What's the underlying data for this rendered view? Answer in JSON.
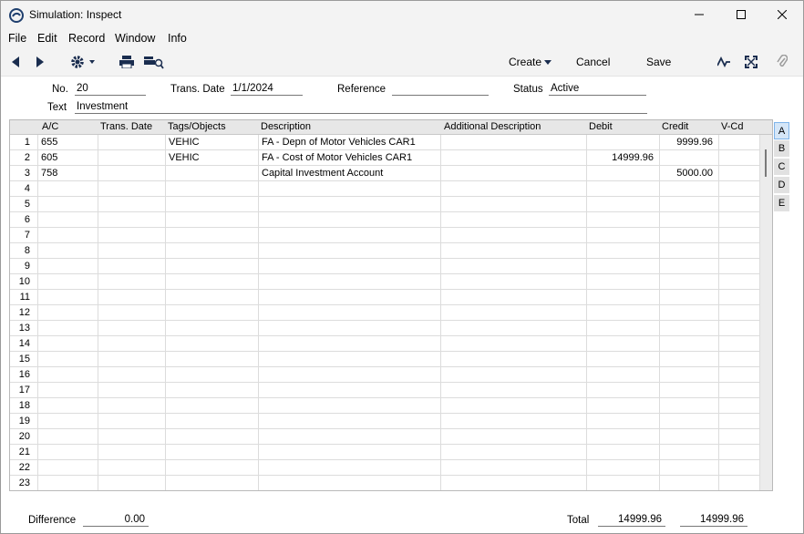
{
  "window": {
    "title": "Simulation: Inspect"
  },
  "menu": [
    "File",
    "Edit",
    "Record",
    "Window",
    "Info"
  ],
  "toolbar": {
    "create_label": "Create",
    "cancel_label": "Cancel",
    "save_label": "Save"
  },
  "header": {
    "no_label": "No.",
    "no_value": "20",
    "trans_date_label": "Trans. Date",
    "trans_date_value": "1/1/2024",
    "reference_label": "Reference",
    "reference_value": "",
    "status_label": "Status",
    "status_value": "Active",
    "text_label": "Text",
    "text_value": "Investment"
  },
  "grid": {
    "columns": [
      "A/C",
      "Trans. Date",
      "Tags/Objects",
      "Description",
      "Additional Description",
      "Debit",
      "Credit",
      "V-Cd"
    ],
    "rows": [
      {
        "n": "1",
        "ac": "655",
        "date": "",
        "tags": "VEHIC",
        "desc": "FA - Depn of Motor Vehicles CAR1",
        "add": "",
        "debit": "",
        "credit": "9999.96",
        "vcd": ""
      },
      {
        "n": "2",
        "ac": "605",
        "date": "",
        "tags": "VEHIC",
        "desc": "FA - Cost of Motor Vehicles CAR1",
        "add": "",
        "debit": "14999.96",
        "credit": "",
        "vcd": ""
      },
      {
        "n": "3",
        "ac": "758",
        "date": "",
        "tags": "",
        "desc": "Capital Investment Account",
        "add": "",
        "debit": "",
        "credit": "5000.00",
        "vcd": ""
      },
      {
        "n": "4"
      },
      {
        "n": "5"
      },
      {
        "n": "6"
      },
      {
        "n": "7"
      },
      {
        "n": "8"
      },
      {
        "n": "9"
      },
      {
        "n": "10"
      },
      {
        "n": "11"
      },
      {
        "n": "12"
      },
      {
        "n": "13"
      },
      {
        "n": "14"
      },
      {
        "n": "15"
      },
      {
        "n": "16"
      },
      {
        "n": "17"
      },
      {
        "n": "18"
      },
      {
        "n": "19"
      },
      {
        "n": "20"
      },
      {
        "n": "21"
      },
      {
        "n": "22"
      },
      {
        "n": "23"
      }
    ]
  },
  "side_tabs": [
    "A",
    "B",
    "C",
    "D",
    "E"
  ],
  "active_tab": "A",
  "footer": {
    "difference_label": "Difference",
    "difference_value": "0.00",
    "total_label": "Total",
    "total_debit": "14999.96",
    "total_credit": "14999.96"
  },
  "colors": {
    "chrome": "#f3f3f3",
    "active_tab_bg": "#d5e6f7",
    "active_tab_border": "#7eb4ea"
  }
}
